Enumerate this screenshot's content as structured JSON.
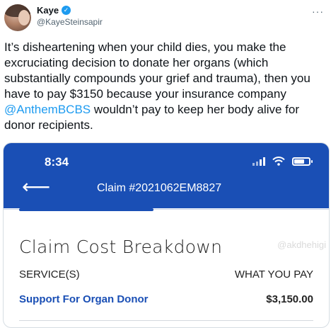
{
  "author": {
    "name": "Kaye",
    "handle": "@KayeSteinsapir",
    "verified_mark": "✓"
  },
  "menu": {
    "more_label": "···"
  },
  "tweet": {
    "text_before": "It’s disheartening when your child dies, you make the excruciating decision to donate her organs (which substantially compounds your grief and trauma), then you have to pay $3150 because your insurance company ",
    "mention": "@AnthemBCBS",
    "text_after": " wouldn’t pay to keep her body alive for donor recipients."
  },
  "phone": {
    "status_time": "8:34",
    "back_arrow": "⟵",
    "claim_title": "Claim #2021062EM8827",
    "section_title": "Claim Cost Breakdown",
    "watermark": "@akdhehigi",
    "columns": {
      "service": "SERVICE(S)",
      "pay": "WHAT YOU PAY"
    },
    "row": {
      "service": "Support For Organ Donor",
      "amount": "$3,150.00"
    }
  },
  "colors": {
    "app_blue": "#1a4fb5",
    "twitter_blue": "#1d9bf0",
    "text": "#0f1419"
  },
  "icons": [
    "verified-badge-icon",
    "more-options-icon",
    "signal-icon",
    "wifi-icon",
    "battery-icon",
    "back-arrow-icon"
  ]
}
